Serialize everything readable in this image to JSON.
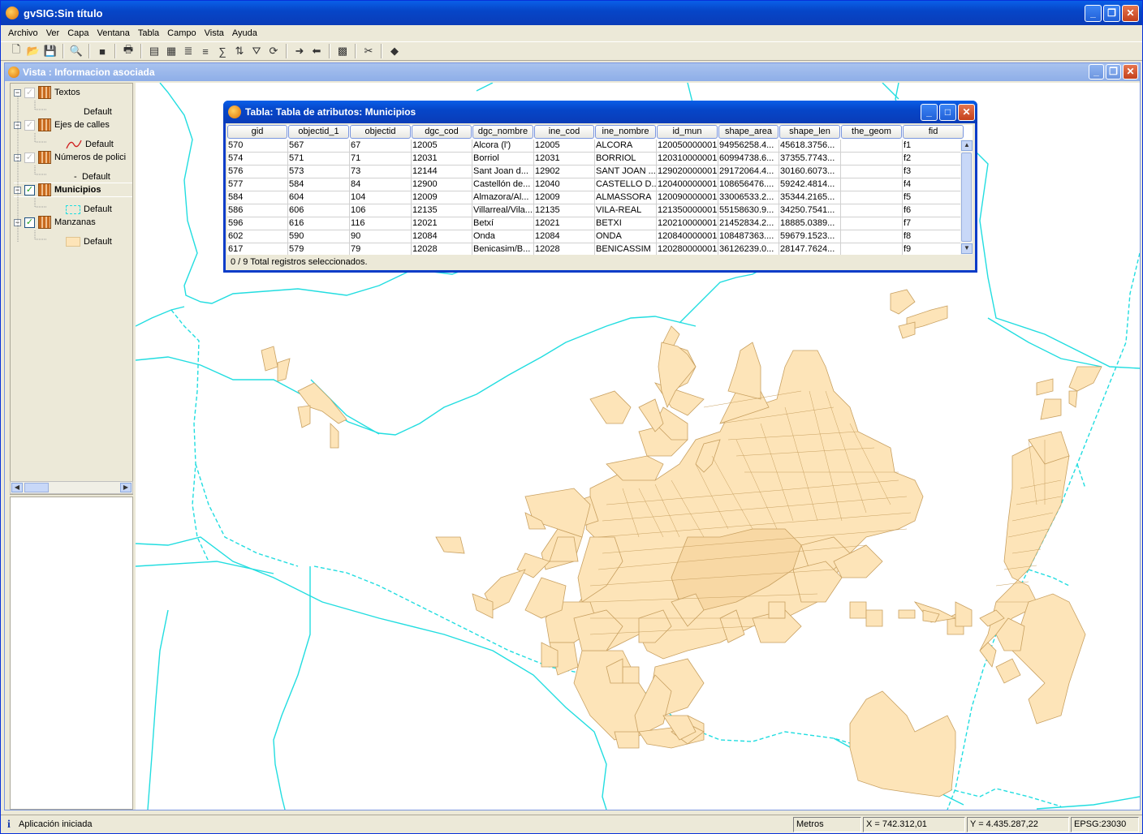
{
  "app": {
    "title": "gvSIG:Sin título",
    "menu": [
      "Archivo",
      "Ver",
      "Capa",
      "Ventana",
      "Tabla",
      "Campo",
      "Vista",
      "Ayuda"
    ]
  },
  "view": {
    "title": "Vista : Informacion asociada",
    "toc": [
      {
        "name": "Textos",
        "legend": "Default",
        "checked": true,
        "dim": true,
        "bold": false
      },
      {
        "name": "Ejes de calles",
        "legend": "Default",
        "checked": true,
        "dim": true,
        "bold": false
      },
      {
        "name": "Números de polici",
        "legend": "Default",
        "checked": true,
        "dim": true,
        "bold": false
      },
      {
        "name": "Municipios",
        "legend": "Default",
        "checked": true,
        "dim": false,
        "bold": true
      },
      {
        "name": "Manzanas",
        "legend": "Default",
        "checked": true,
        "dim": false,
        "bold": false
      }
    ]
  },
  "table_window": {
    "title": "Tabla: Tabla de atributos: Municipios",
    "columns": [
      "gid",
      "objectid_1",
      "objectid",
      "dgc_cod",
      "dgc_nombre",
      "ine_cod",
      "ine_nombre",
      "id_mun",
      "shape_area",
      "shape_len",
      "the_geom",
      "fid"
    ],
    "rows": [
      [
        "570",
        "567",
        "67",
        "12005",
        "Alcora (l')",
        "12005",
        "ALCORA",
        "120050000001",
        "94956258.4...",
        "45618.3756...",
        "",
        "f1"
      ],
      [
        "574",
        "571",
        "71",
        "12031",
        "Borriol",
        "12031",
        "BORRIOL",
        "120310000001",
        "60994738.6...",
        "37355.7743...",
        "",
        "f2"
      ],
      [
        "576",
        "573",
        "73",
        "12144",
        "Sant Joan d...",
        "12902",
        "SANT JOAN ...",
        "129020000001",
        "29172064.4...",
        "30160.6073...",
        "",
        "f3"
      ],
      [
        "577",
        "584",
        "84",
        "12900",
        "Castellón de...",
        "12040",
        "CASTELLO D...",
        "120400000001",
        "108656476....",
        "59242.4814...",
        "",
        "f4"
      ],
      [
        "584",
        "604",
        "104",
        "12009",
        "Almazora/Al...",
        "12009",
        "ALMASSORA",
        "120090000001",
        "33006533.2...",
        "35344.2165...",
        "",
        "f5"
      ],
      [
        "586",
        "606",
        "106",
        "12135",
        "Villarreal/Vila...",
        "12135",
        "VILA-REAL",
        "121350000001",
        "55158630.9...",
        "34250.7541...",
        "",
        "f6"
      ],
      [
        "596",
        "616",
        "116",
        "12021",
        "Betxí",
        "12021",
        "BETXI",
        "120210000001",
        "21452834.2...",
        "18885.0389...",
        "",
        "f7"
      ],
      [
        "602",
        "590",
        "90",
        "12084",
        "Onda",
        "12084",
        "ONDA",
        "120840000001",
        "108487363....",
        "59679.1523...",
        "",
        "f8"
      ],
      [
        "617",
        "579",
        "79",
        "12028",
        "Benicasim/B...",
        "12028",
        "BENICASSIM",
        "120280000001",
        "36126239.0...",
        "28147.7624...",
        "",
        "f9"
      ]
    ],
    "status": "0 / 9 Total registros seleccionados."
  },
  "statusbar": {
    "message": "Aplicación iniciada",
    "units": "Metros",
    "x": "X = 742.312,01",
    "y": "Y = 4.435.287,22",
    "epsg": "EPSG:23030"
  },
  "colors": {
    "boundary": "#22dde0",
    "parcel_fill": "#fde4b8",
    "parcel_stroke": "#c8a060",
    "title_blue": "#0646c8"
  }
}
